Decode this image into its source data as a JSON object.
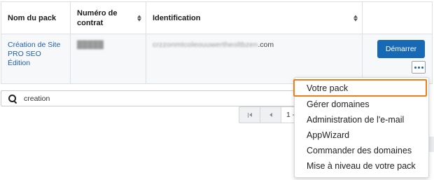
{
  "table": {
    "headers": {
      "pack_name": "Nom du pack",
      "contract_number": "Numéro de contrat",
      "identification": "Identification"
    },
    "row": {
      "pack_name_lines": [
        "Création de Site",
        "PRO SEO",
        "Édition"
      ],
      "contract_number": "█████",
      "identification_blurred": "crzzonmtcoleouuwertheoltbzen",
      "identification_suffix": ".com",
      "start_label": "Démarrer",
      "more_icon": "ellipsis-icon"
    }
  },
  "search": {
    "value": "creation",
    "icon": "search-icon"
  },
  "pagination": {
    "first_icon": "first-page-icon",
    "prev_icon": "prev-page-icon",
    "current": "1 -"
  },
  "dropdown": {
    "items": [
      "Votre pack",
      "Gérer domaines",
      "Administration de l'e-mail",
      "AppWizard",
      "Commander des domaines",
      "Mise à niveau de votre pack"
    ]
  },
  "colors": {
    "accent": "#1869b5",
    "link": "#1f5fa6",
    "highlight_border": "#f07c1a"
  }
}
